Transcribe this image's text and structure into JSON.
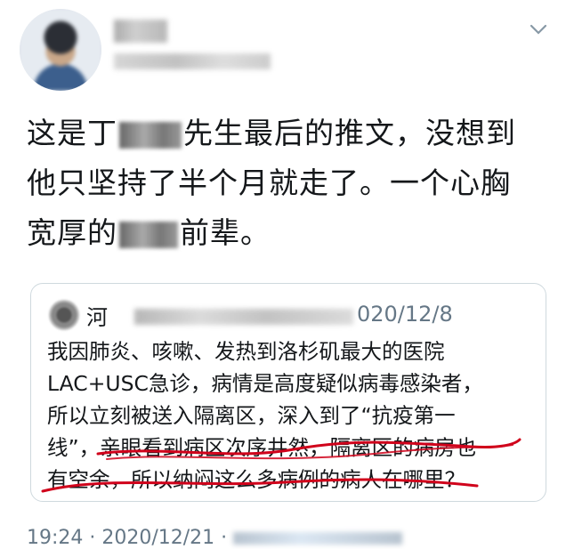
{
  "tweet": {
    "text_lines": [
      [
        "这是丁",
        "先生最后的推文，没想到"
      ],
      "他只坚持了半个月就走了。一个心胸",
      [
        "宽厚的",
        "前辈。"
      ]
    ],
    "footer_time": "19:24 · 2020/12/21 ·"
  },
  "quoted": {
    "name_visible": "河",
    "date_visible": "020/12/8",
    "lines": [
      "我因肺炎、咳嗽、发热到洛杉矶最大的医院",
      "LAC+USC急诊，病情是高度疑似病毒感染者，",
      "所以立刻被送入隔离区，深入到了“抗疫第一",
      "线”，亲眼看到病区次序井然，隔离区的病房也",
      "有空余，所以纳闷这么多病例的病人在哪里？"
    ]
  },
  "icons": {
    "caret": "chevron-down-icon"
  },
  "colors": {
    "annotation": "#d0021b",
    "secondary_text": "#657786",
    "border": "#cfd9de"
  }
}
